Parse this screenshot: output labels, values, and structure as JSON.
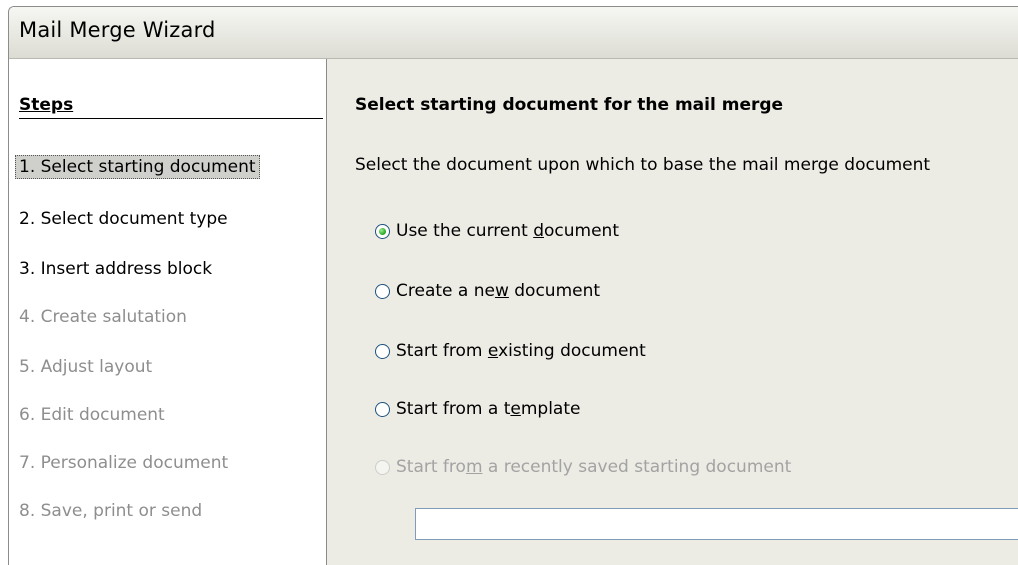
{
  "window": {
    "title": "Mail Merge Wizard"
  },
  "sidebar": {
    "heading": "Steps",
    "steps": [
      {
        "label": "1. Select starting document",
        "state": "selected"
      },
      {
        "label": "2. Select document type",
        "state": "enabled"
      },
      {
        "label": "3. Insert address block",
        "state": "enabled"
      },
      {
        "label": "4. Create salutation",
        "state": "disabled"
      },
      {
        "label": "5. Adjust layout",
        "state": "disabled"
      },
      {
        "label": "6. Edit document",
        "state": "disabled"
      },
      {
        "label": "7. Personalize document",
        "state": "disabled"
      },
      {
        "label": "8. Save, print or send",
        "state": "disabled"
      }
    ]
  },
  "main": {
    "heading": "Select starting document for the mail merge",
    "description": "Select the document upon which to base the mail merge document",
    "options": [
      {
        "pre": "Use the current ",
        "mnemonic": "d",
        "post": "ocument",
        "checked": true,
        "enabled": true
      },
      {
        "pre": "Create a ne",
        "mnemonic": "w",
        "post": " document",
        "checked": false,
        "enabled": true
      },
      {
        "pre": "Start from ",
        "mnemonic": "e",
        "post": "xisting document",
        "checked": false,
        "enabled": true
      },
      {
        "pre": "Start from a t",
        "mnemonic": "e",
        "post": "mplate",
        "checked": false,
        "enabled": true
      },
      {
        "pre": "Start fro",
        "mnemonic": "m",
        "post": " a recently saved starting document",
        "checked": false,
        "enabled": false
      }
    ],
    "recent_document_value": ""
  }
}
